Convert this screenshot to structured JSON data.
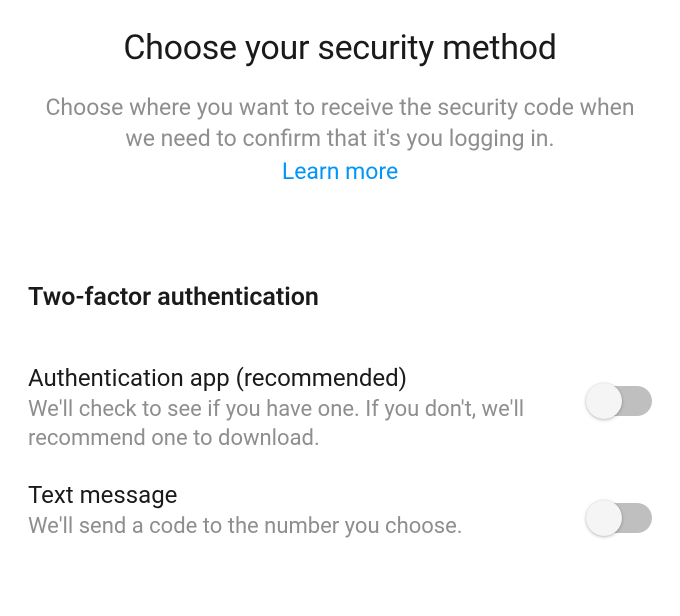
{
  "header": {
    "title": "Choose your security method",
    "subtitle": "Choose where you want to receive the security code when we need to confirm that it's you logging in.",
    "learn_more": "Learn more"
  },
  "section": {
    "title": "Two-factor authentication"
  },
  "options": {
    "auth_app": {
      "title": "Authentication app (recommended)",
      "desc": "We'll check to see if you have one. If you don't, we'll recommend one to download."
    },
    "text_message": {
      "title": "Text message",
      "desc": "We'll send a code to the number you choose."
    }
  }
}
